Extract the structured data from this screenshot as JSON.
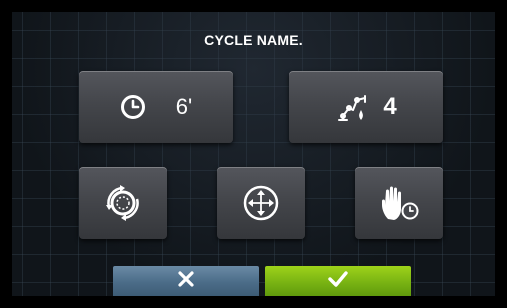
{
  "screen": {
    "title": "CYCLE NAME."
  },
  "buttons": {
    "time": {
      "icon": "clock-icon",
      "value": "6'"
    },
    "dispensing": {
      "icon": "dosing-arm-icon",
      "value": "4"
    },
    "rotation": {
      "icon": "drum-rotation-icon"
    },
    "drain": {
      "icon": "four-direction-arrows-icon"
    },
    "manual_pause": {
      "icon": "hand-timer-icon"
    }
  },
  "footer": {
    "cancel": {
      "icon": "close-x-icon",
      "color": "#4b6c88"
    },
    "confirm": {
      "icon": "checkmark-icon",
      "color": "#79b313"
    }
  },
  "colors": {
    "background": "#10151a",
    "button": "#44464b"
  }
}
